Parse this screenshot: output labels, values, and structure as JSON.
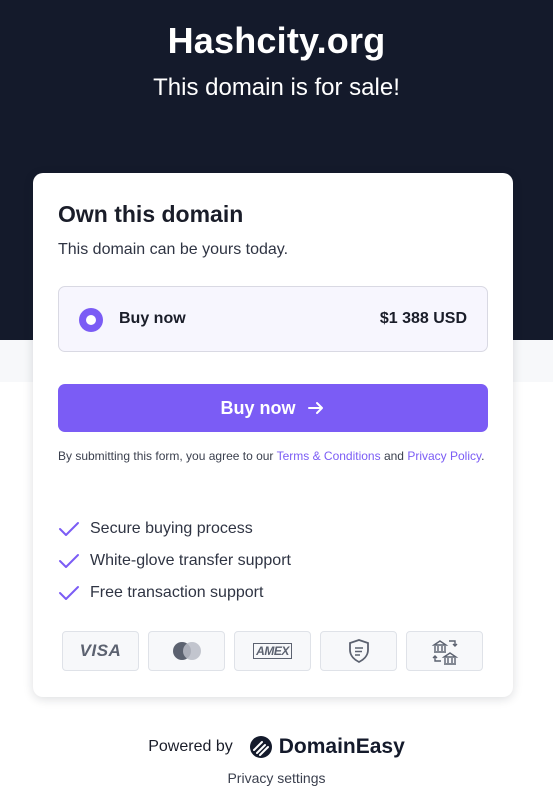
{
  "hero": {
    "domain": "Hashcity.org",
    "subtitle": "This domain is for sale!"
  },
  "card": {
    "title": "Own this domain",
    "subtitle": "This domain can be yours today.",
    "option": {
      "label": "Buy now",
      "price": "$1 388 USD",
      "selected": true
    },
    "buy_button_label": "Buy now",
    "terms": {
      "prefix": "By submitting this form, you agree to our ",
      "terms_link": "Terms & Conditions",
      "middle": " and ",
      "privacy_link": "Privacy Policy",
      "suffix": "."
    },
    "features": [
      "Secure buying process",
      "White-glove transfer support",
      "Free transaction support"
    ],
    "payment_methods": {
      "visa": "VISA",
      "mastercard": "mastercard-icon",
      "amex": "AMEX",
      "escrow": "shield-icon",
      "bank_transfer": "bank-transfer-icon"
    }
  },
  "footer": {
    "powered_by": "Powered by",
    "brand": "DomainEasy",
    "privacy_settings": "Privacy settings"
  },
  "colors": {
    "hero_bg": "#141a2b",
    "accent": "#7b5cf5",
    "option_bg": "#f7f6fe"
  }
}
